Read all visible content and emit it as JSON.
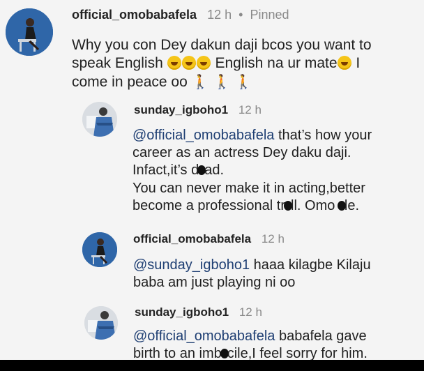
{
  "comments": [
    {
      "username": "official_omobabafela",
      "time": "12 h",
      "separator": "•",
      "pinned": "Pinned",
      "line1": "Why you con Dey dakun daji bcos you want to",
      "line2_a": "speak English",
      "line2_b": "English na ur mate",
      "line2_c": "I",
      "line3": "come in peace oo",
      "emoji": "laughing-tears",
      "walker_emoji": "woman-walking"
    },
    {
      "username": "sunday_igboho1",
      "time": "12 h",
      "mention": "@official_omobabafela",
      "line1_rest": " that’s how your",
      "line2": "career as an actress Dey daku daji.",
      "line3_a": "Infact,it’s d",
      "line3_b": "ad.",
      "line4": "You can never make it in acting,better",
      "line5_a": "become a professional tr",
      "line5_b": "ll. Omo ",
      "line5_c": "le."
    },
    {
      "username": "official_omobabafela",
      "time": "12 h",
      "mention": "@sunday_igboho1",
      "line1_rest": " haaa kilagbe Kilaju",
      "line2": "baba am just playing ni oo"
    },
    {
      "username": "sunday_igboho1",
      "time": "12 h",
      "mention": "@official_omobabafela",
      "line1_rest": " babafela gave",
      "line2_a": "birth to an imb",
      "line2_b": "cile,I feel sorry for him."
    }
  ],
  "colors": {
    "mention": "#1f3f73",
    "meta": "#8a8a8a",
    "avatar_blue": "#2f66a8"
  }
}
